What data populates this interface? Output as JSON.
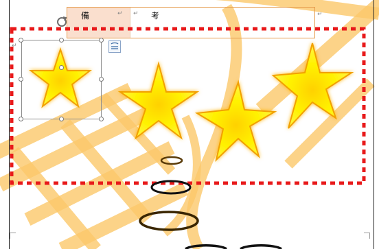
{
  "table": {
    "header_label": "備　　考",
    "para_mark": "↵"
  },
  "icons": {
    "rotate": "rotate-handle-icon",
    "layout_options": "layout-options-icon",
    "paragraph": "paragraph-mark-icon"
  },
  "colors": {
    "dashed_frame": "#e8191a",
    "star_fill": "#fff200",
    "star_glow": "#ffb300",
    "watermark": "#fbc86a",
    "table_border": "#e59a4a",
    "header_fill": "#f5c4a6",
    "ellipse": "#111111"
  }
}
